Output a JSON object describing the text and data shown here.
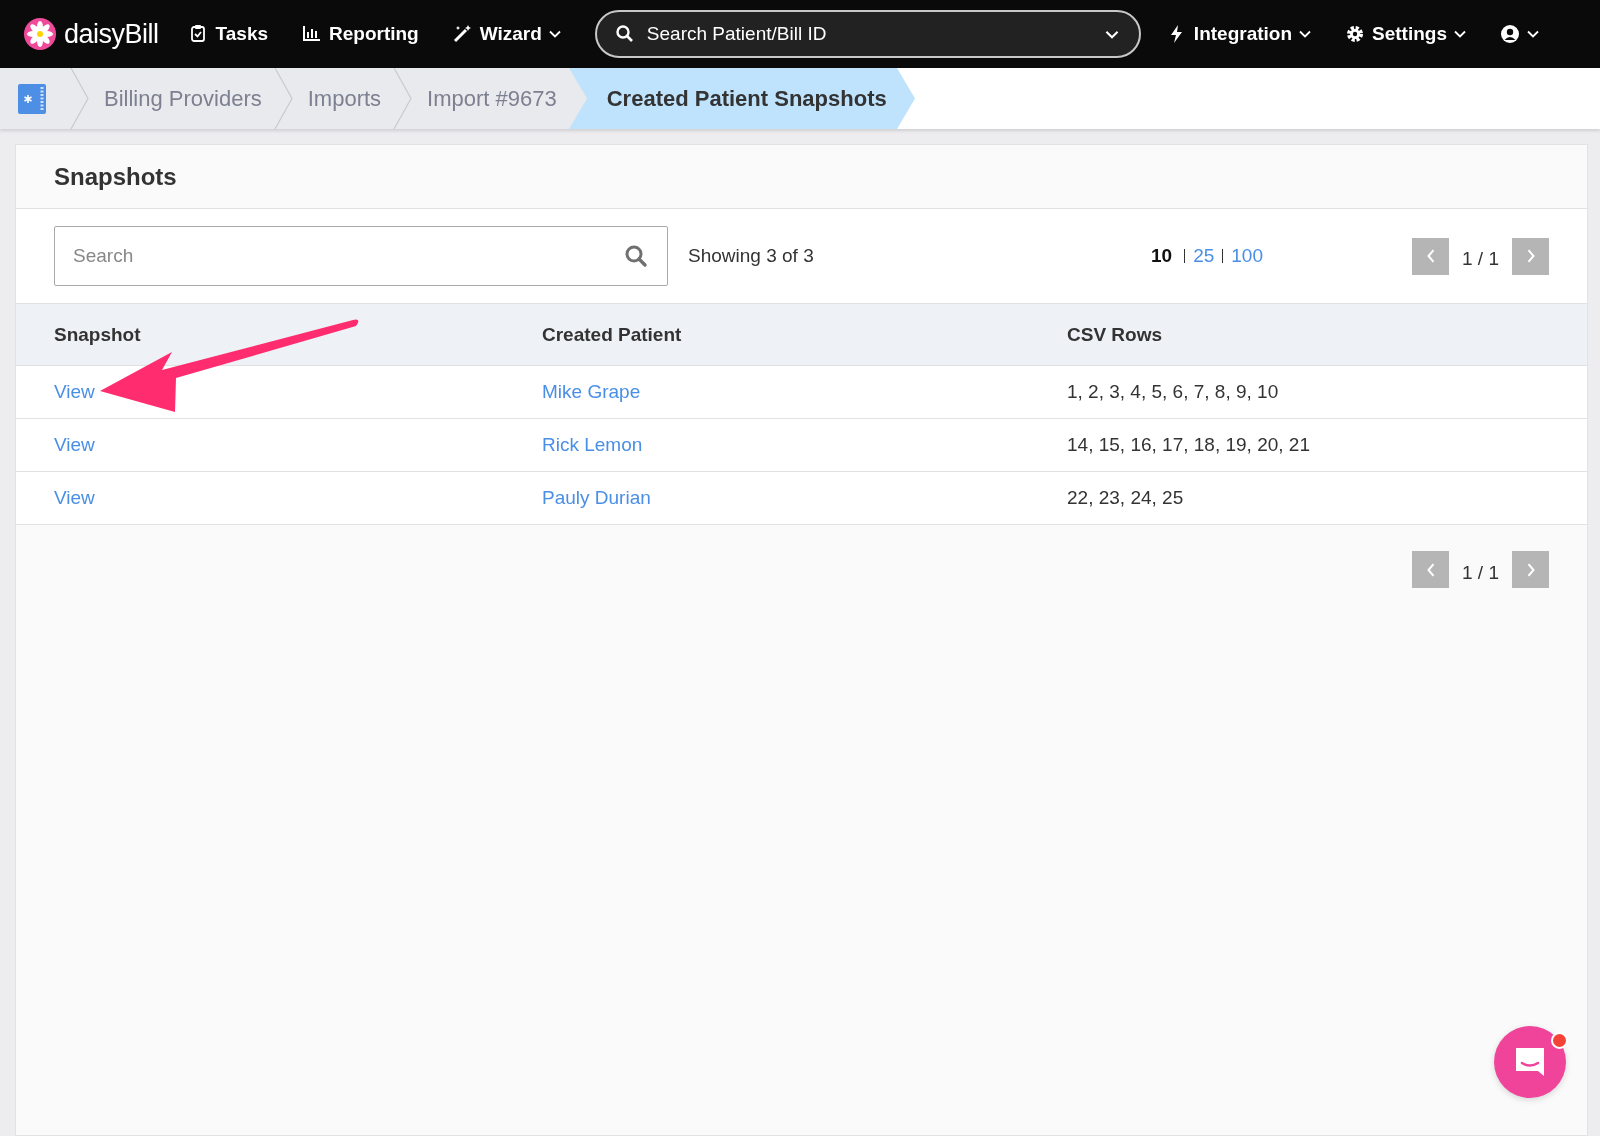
{
  "navbar": {
    "logo": "daisyBill",
    "items": [
      {
        "label": "Tasks",
        "dropdown": false
      },
      {
        "label": "Reporting",
        "dropdown": false
      },
      {
        "label": "Wizard",
        "dropdown": true
      }
    ],
    "search": {
      "placeholder": "Search Patient/Bill ID"
    },
    "right_items": [
      {
        "label": "Integration",
        "dropdown": true
      },
      {
        "label": "Settings",
        "dropdown": true
      },
      {
        "dropdown": true
      }
    ]
  },
  "breadcrumbs": [
    {
      "label": "Billing Providers",
      "selected": false
    },
    {
      "label": "Imports",
      "selected": false
    },
    {
      "label": "Import #9673",
      "selected": false
    },
    {
      "label": "Created Patient Snapshots",
      "selected": true
    }
  ],
  "panel": {
    "title": "Snapshots",
    "search": {
      "placeholder": "Search"
    },
    "showing": "Showing 3 of 3",
    "page_sizes": [
      {
        "label": "10",
        "selected": true
      },
      {
        "label": "25",
        "selected": false
      },
      {
        "label": "100",
        "selected": false
      }
    ],
    "pager_top": "1 / 1",
    "pager_bottom": "1 / 1",
    "table": {
      "columns": [
        "Snapshot",
        "Created Patient",
        "CSV Rows"
      ],
      "rows": [
        {
          "snapshot": "View",
          "patient": "Mike Grape",
          "csv_rows": "1, 2, 3, 4, 5, 6, 7, 8, 9, 10"
        },
        {
          "snapshot": "View",
          "patient": "Rick Lemon",
          "csv_rows": "14, 15, 16, 17, 18, 19, 20, 21"
        },
        {
          "snapshot": "View",
          "patient": "Pauly Durian",
          "csv_rows": "22, 23, 24, 25"
        }
      ]
    }
  },
  "chat": {
    "unread": true
  }
}
